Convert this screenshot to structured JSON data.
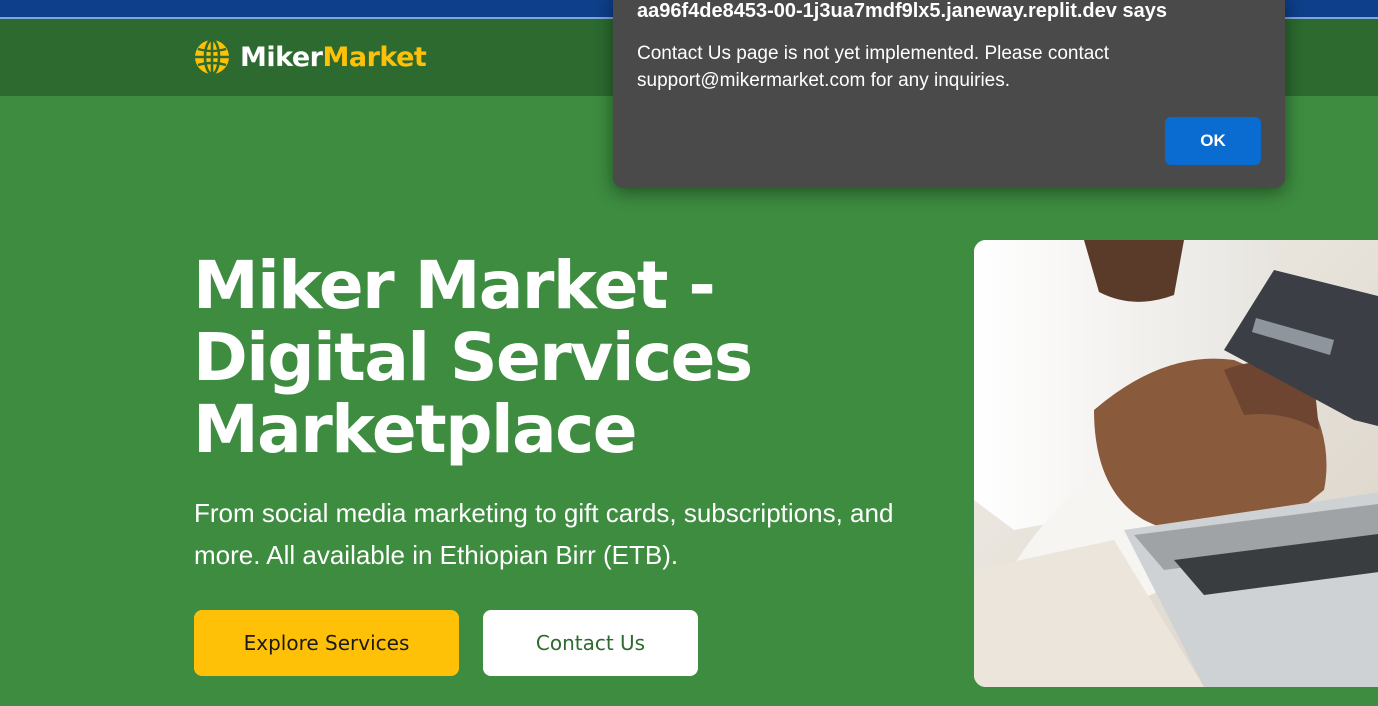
{
  "header": {
    "logo_part1": "Miker",
    "logo_part2": "Market",
    "logo_icon": "globe-icon"
  },
  "hero": {
    "title_line1": "Miker Market -",
    "title_line2": "Digital Services",
    "title_line3": "Marketplace",
    "subtitle": "From social media marketing to gift cards, subscriptions, and more. All available in Ethiopian Birr (ETB).",
    "primary_button": "Explore Services",
    "secondary_button": "Contact Us",
    "image": "person-holding-credit-card-at-laptop"
  },
  "alert": {
    "title": "aa96f4de8453-00-1j3ua7mdf9lx5.janeway.replit.dev says",
    "message": "Contact Us page is not yet implemented. Please contact support@mikermarket.com for any inquiries.",
    "ok_label": "OK"
  },
  "colors": {
    "hero_bg": "#3d8c40",
    "navbar_bg": "#2c6a2f",
    "accent": "#ffc107",
    "dialog_bg": "#4a4a4a",
    "ok_button": "#0a6cd0"
  }
}
